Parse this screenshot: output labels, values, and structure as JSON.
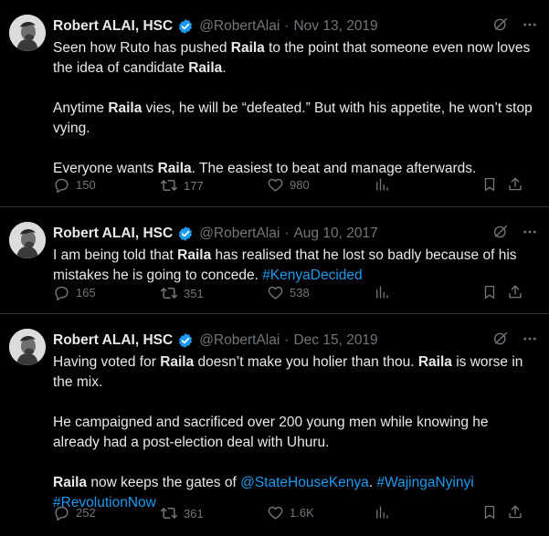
{
  "tweets": [
    {
      "name": "Robert ALAI, HSC",
      "handle": "@RobertAlai",
      "separator": "·",
      "date": "Nov 13, 2019",
      "body": [
        {
          "t": "Seen how Ruto has pushed "
        },
        {
          "b": "Raila"
        },
        {
          "t": " to the point that someone even now loves the idea of candidate "
        },
        {
          "b": "Raila"
        },
        {
          "t": ".\n\nAnytime "
        },
        {
          "b": "Raila"
        },
        {
          "t": " vies, he will be “defeated.” But with his appetite, he won’t stop vying.\n\nEveryone wants "
        },
        {
          "b": "Raila"
        },
        {
          "t": ". The easiest to beat and manage afterwards."
        }
      ],
      "replies": "150",
      "retweets": "177",
      "likes": "980"
    },
    {
      "name": "Robert ALAI, HSC",
      "handle": "@RobertAlai",
      "separator": "·",
      "date": "Aug 10, 2017",
      "body": [
        {
          "t": "I am being told that "
        },
        {
          "b": "Raila"
        },
        {
          "t": " has realised that he lost so badly because of his mistakes he is going to concede. "
        },
        {
          "l": "#KenyaDecided"
        }
      ],
      "replies": "165",
      "retweets": "351",
      "likes": "538"
    },
    {
      "name": "Robert ALAI, HSC",
      "handle": "@RobertAlai",
      "separator": "·",
      "date": "Dec 15, 2019",
      "body": [
        {
          "t": "Having voted for "
        },
        {
          "b": "Raila"
        },
        {
          "t": " doesn’t make you holier than thou. "
        },
        {
          "b": "Raila"
        },
        {
          "t": " is worse in the mix.\n\nHe campaigned and sacrificed over 200 young men while knowing he already had a post-election deal with Uhuru.\n\n"
        },
        {
          "b": "Raila"
        },
        {
          "t": " now keeps the gates of "
        },
        {
          "l": "@StateHouseKenya"
        },
        {
          "t": ". "
        },
        {
          "l": "#WajingaNyinyi"
        },
        {
          "t": "\n"
        },
        {
          "l": "#RevolutionNow"
        }
      ],
      "replies": "252",
      "retweets": "361",
      "likes": "1.6K"
    }
  ],
  "icons": {
    "verified": "verified-badge-icon",
    "grok": "grok-icon",
    "more": "more-icon",
    "reply": "reply-icon",
    "retweet": "retweet-icon",
    "like": "heart-icon",
    "views": "views-icon",
    "bookmark": "bookmark-icon",
    "share": "share-icon"
  },
  "colors": {
    "background": "#000000",
    "text": "#e7e9ea",
    "muted": "#71767b",
    "link": "#1d9bf0",
    "border": "#2f3336"
  }
}
